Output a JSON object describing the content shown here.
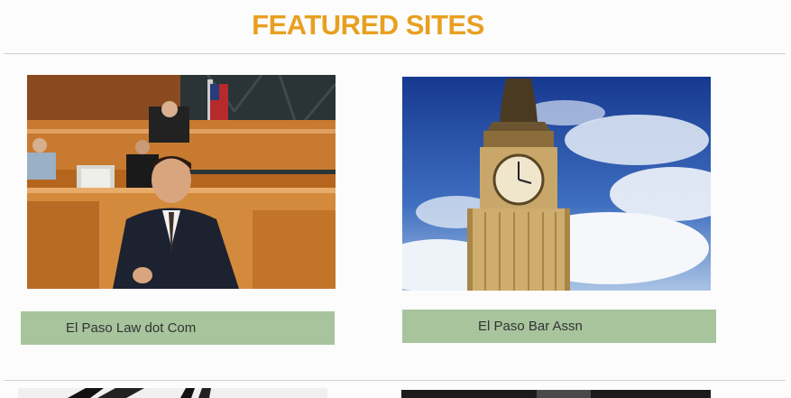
{
  "header": {
    "title": "FEATURED SITES",
    "title_color": "#e8a020"
  },
  "featured": [
    {
      "label": "El Paso Law dot Com",
      "image": "courtroom-photo"
    },
    {
      "label": "El Paso Bar Assn",
      "image": "clock-tower-photo"
    }
  ],
  "label_bg": "#a7c49d"
}
